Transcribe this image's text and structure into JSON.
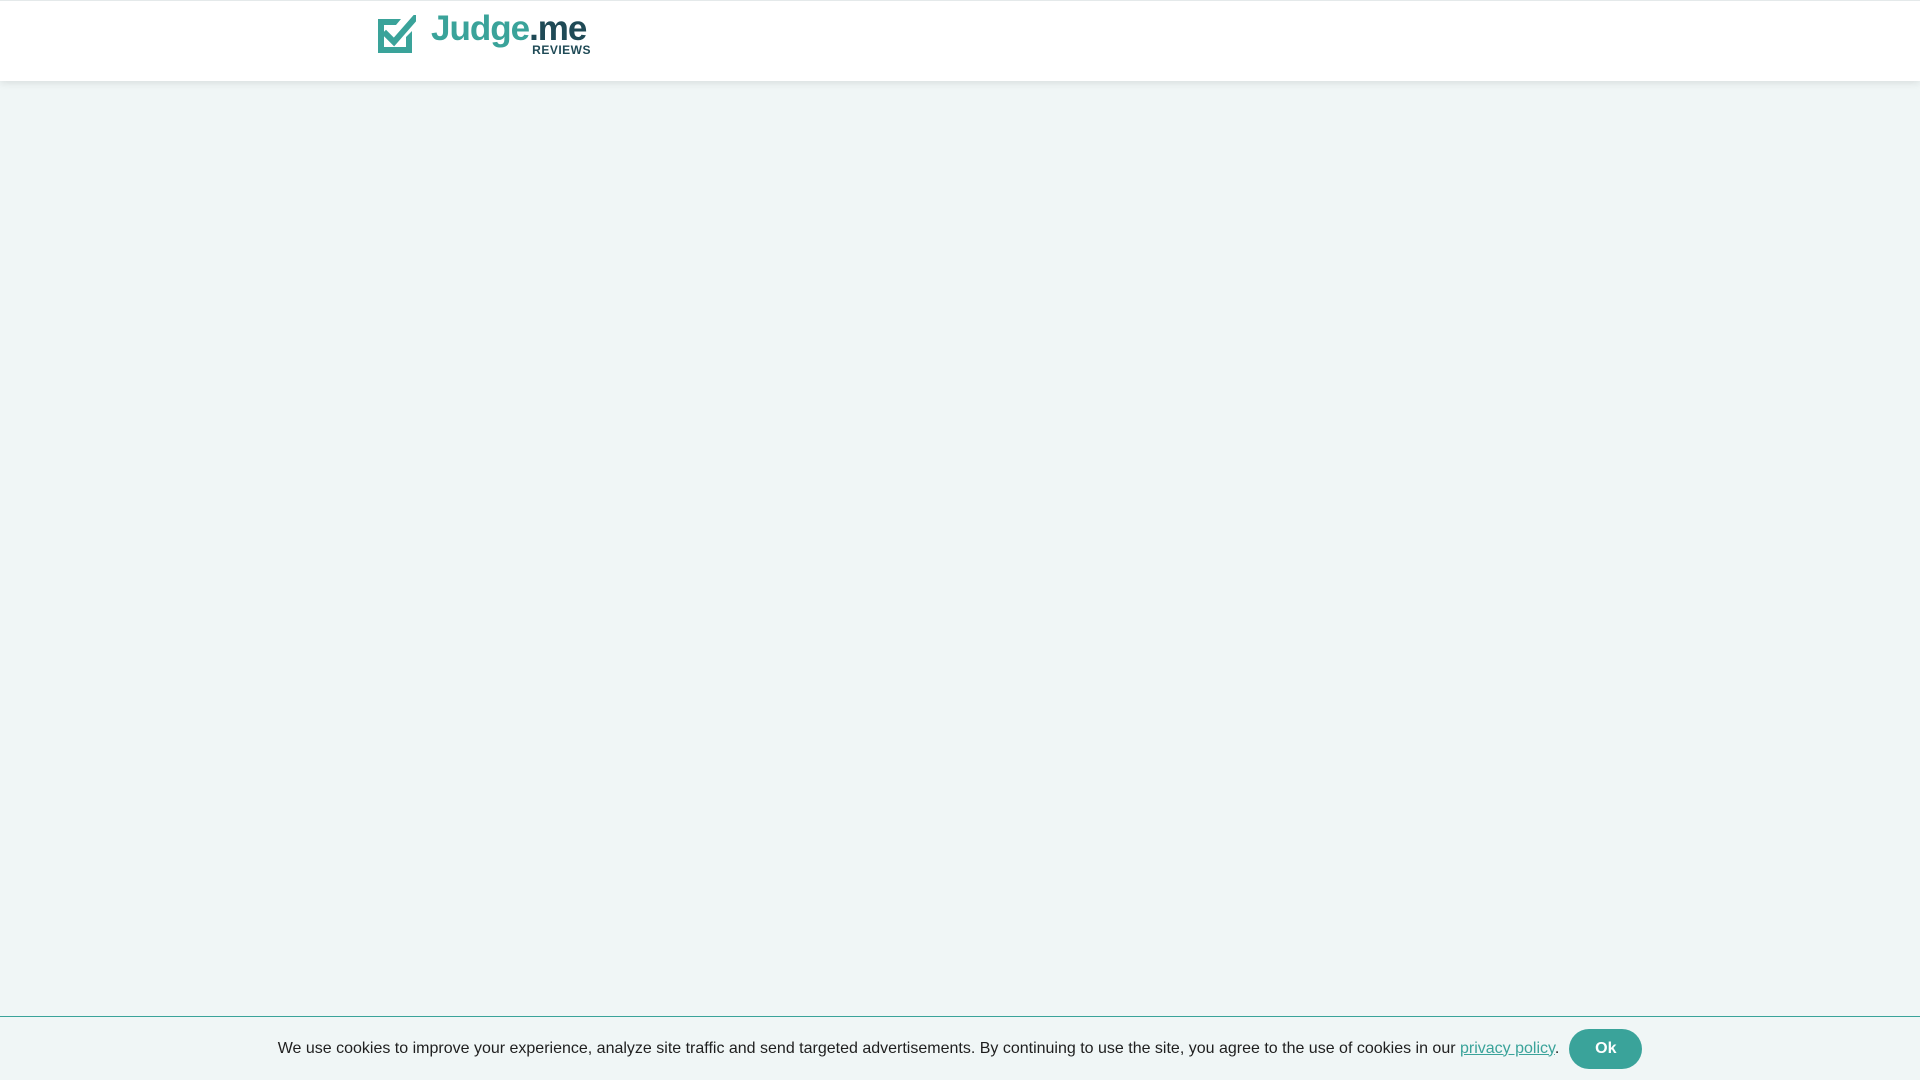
{
  "header": {
    "logo": {
      "word_main": "Judge",
      "word_suffix": ".me",
      "subtitle": "REVIEWS",
      "icon": "checkbox-check-icon",
      "colors": {
        "teal": "#3aa39a",
        "navy": "#1f4a56"
      }
    }
  },
  "cookie_banner": {
    "text": "We use cookies to improve your experience, analyze site traffic and send targeted advertisements. By continuing to use the site, you agree to the use of cookies in our ",
    "link_text": "privacy policy",
    "after_link": ".",
    "ok_label": "Ok",
    "accent_color": "#3aa39a"
  }
}
